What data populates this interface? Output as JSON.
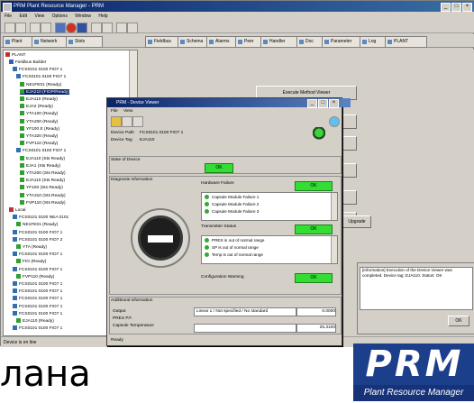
{
  "app": {
    "title": "PRM Plant Resource Manager - PRM"
  },
  "menu": [
    "File",
    "Edit",
    "View",
    "Options",
    "Window",
    "Help"
  ],
  "tabs": [
    "Plant",
    "Network",
    "Slots",
    "Fieldbus",
    "Schema",
    "Alarms",
    "Peer",
    "Handler",
    "Doc",
    "Parameter",
    "Log",
    "PLANT"
  ],
  "tree": {
    "root": "PLANT",
    "items": [
      "Fieldbus Builder",
      "FCS0101 0100 FIO7 1",
      "FCS0101 0100 FIO7 1",
      "NE1FE01 (Ready)",
      "EJA210 (FIOP/Ready)",
      "EJA110 (Ready)",
      "EJA2 (Ready)",
      "YTA100 (Ready)",
      "YTA200 (Ready)",
      "YF100 E (Ready)",
      "YTA320 (Ready)",
      "FVP110 (Ready)",
      "FCS0101 0100 FIO7 1",
      "EJA110 (Sts Ready)",
      "EJA1 (Sts Ready)",
      "YTA200 (Sts Ready)",
      "EJA110 (Sts Ready)",
      "YF100 (Sts Ready)",
      "YTA310 (Sts Ready)",
      "FVP110 (Sts Ready)",
      "Local",
      "FCS0101 0100 NEA 0101",
      "NE1FE01 (Ready)",
      "FCS0101 0100 FIO7 1",
      "FCS0101 0100 FIO7 2",
      "YTA (Ready)",
      "FCS0101 0100 FIO7 1",
      "FIO (Ready)",
      "FCS0101 0100 FIO7 1",
      "FVP110 (Ready)",
      "FCS0101 0100 FIO7 1",
      "FCS0101 0100 FIO7 1",
      "FCS0101 0100 FIO7 1",
      "FCS0101 0100 FIO7 1",
      "FCS0101 0100 FIO7 1",
      "EJA110 (Ready)",
      "FCS0101 0100 FIO7 1"
    ]
  },
  "right_buttons": [
    "Execute Method Viewer",
    "",
    "",
    "",
    "",
    "",
    "Upgrade"
  ],
  "dialog": {
    "title": "PRM - Device Viewer",
    "menu": [
      "File",
      "View"
    ],
    "device_path_label": "Device Path",
    "device_path_value": "FCS0101 0100 FIO7 1",
    "device_tag_label": "Device Tag",
    "device_tag_value": "EJA110",
    "state_label": "State of Device",
    "state_btn": "OK",
    "diag_label": "Diagnosis Information",
    "hardware_label": "Hardware Failure",
    "hardware_btn": "OK",
    "hardware_items": [
      "Capsule Module Failure 1",
      "Capsule Module Failure 2",
      "Capsule Module Failure 3"
    ],
    "transmitter_label": "Transmitter Status",
    "transmitter_btn": "OK",
    "transmitter_items": [
      "PRES in out of normal range",
      "SP is out of normal range",
      "Temp is out of normal range"
    ],
    "config_label": "Configuration Warning",
    "config_btn": "OK",
    "additional_label": "Additional Information",
    "rows": [
      {
        "label": "Output",
        "value": "Linear 1 / Not specified / No standard",
        "num": "0.0000"
      },
      {
        "label": "PRES P.F.",
        "value": "",
        "num": ""
      },
      {
        "label": "Capsule Temperature",
        "value": "",
        "num": "25.3100"
      }
    ],
    "bottom_btn": "Ready",
    "ind_status_color": "#33cc33",
    "icons": [
      "folder-icon",
      "print-icon",
      "edit-icon",
      "help-icon"
    ]
  },
  "log": {
    "text": "[Information] Execution of the Device Viewer was completed. Device tag: EJA110. Status: OK",
    "btn": "OK"
  },
  "status": {
    "text": "Device is on line"
  },
  "overlay_text": "лана",
  "logo": {
    "brand": "PRM",
    "subtitle": "Plant Resource Manager",
    "color": "#1c3f8c"
  },
  "colors": {
    "ok_green": "#33dd33",
    "title_blue": "#0a246a"
  }
}
